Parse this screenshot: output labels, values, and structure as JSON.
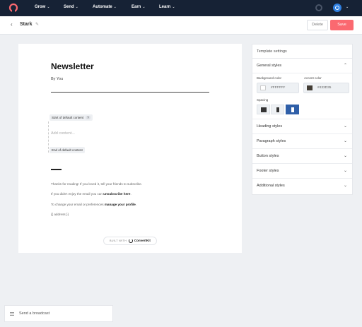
{
  "nav": {
    "logo_icon": "convertkit-logo-icon",
    "items": [
      {
        "label": "Grow"
      },
      {
        "label": "Send"
      },
      {
        "label": "Automate"
      },
      {
        "label": "Earn"
      },
      {
        "label": "Learn"
      }
    ],
    "chevron": "⌄"
  },
  "header": {
    "back_glyph": "‹",
    "title": "Stark",
    "delete_label": "Delete",
    "save_label": "Save"
  },
  "email": {
    "title": "Newsletter",
    "author": "By You",
    "start_tag": "Start of default content",
    "help_glyph": "?",
    "add_content_placeholder": "Add content...",
    "end_tag": "End of default content",
    "line1": "Thanks for reading! If you loved it, tell your friends to subscribe.",
    "line2_prefix": "If you didn't enjoy the email you can ",
    "line2_link": "unsubscribe here",
    "line2_suffix": ".",
    "line3_prefix": "To change your email or preferences ",
    "line3_link": "manage your profile",
    "line3_suffix": ".",
    "address": "{{ address }}",
    "badge_prefix": "BUILT WITH",
    "badge_brand": "ConvertKit"
  },
  "settings": {
    "header": "Template settings",
    "general": {
      "label": "General styles",
      "background_label": "Background color",
      "background_value": "#FFFFFF",
      "accent_label": "Accent color",
      "accent_value": "#433D35",
      "spacing_label": "Spacing"
    },
    "sections": [
      {
        "label": "Heading styles"
      },
      {
        "label": "Paragraph styles"
      },
      {
        "label": "Button styles"
      },
      {
        "label": "Footer styles"
      },
      {
        "label": "Additional styles"
      }
    ],
    "chev_open": "⌃",
    "chev_closed": "⌄"
  },
  "broadcast": {
    "label": "Send a broadcast"
  },
  "colors": {
    "nav_bg": "#162235",
    "save_bg": "#FB6970",
    "accent": "#433D35",
    "spacing_active": "#2F5FA8"
  }
}
